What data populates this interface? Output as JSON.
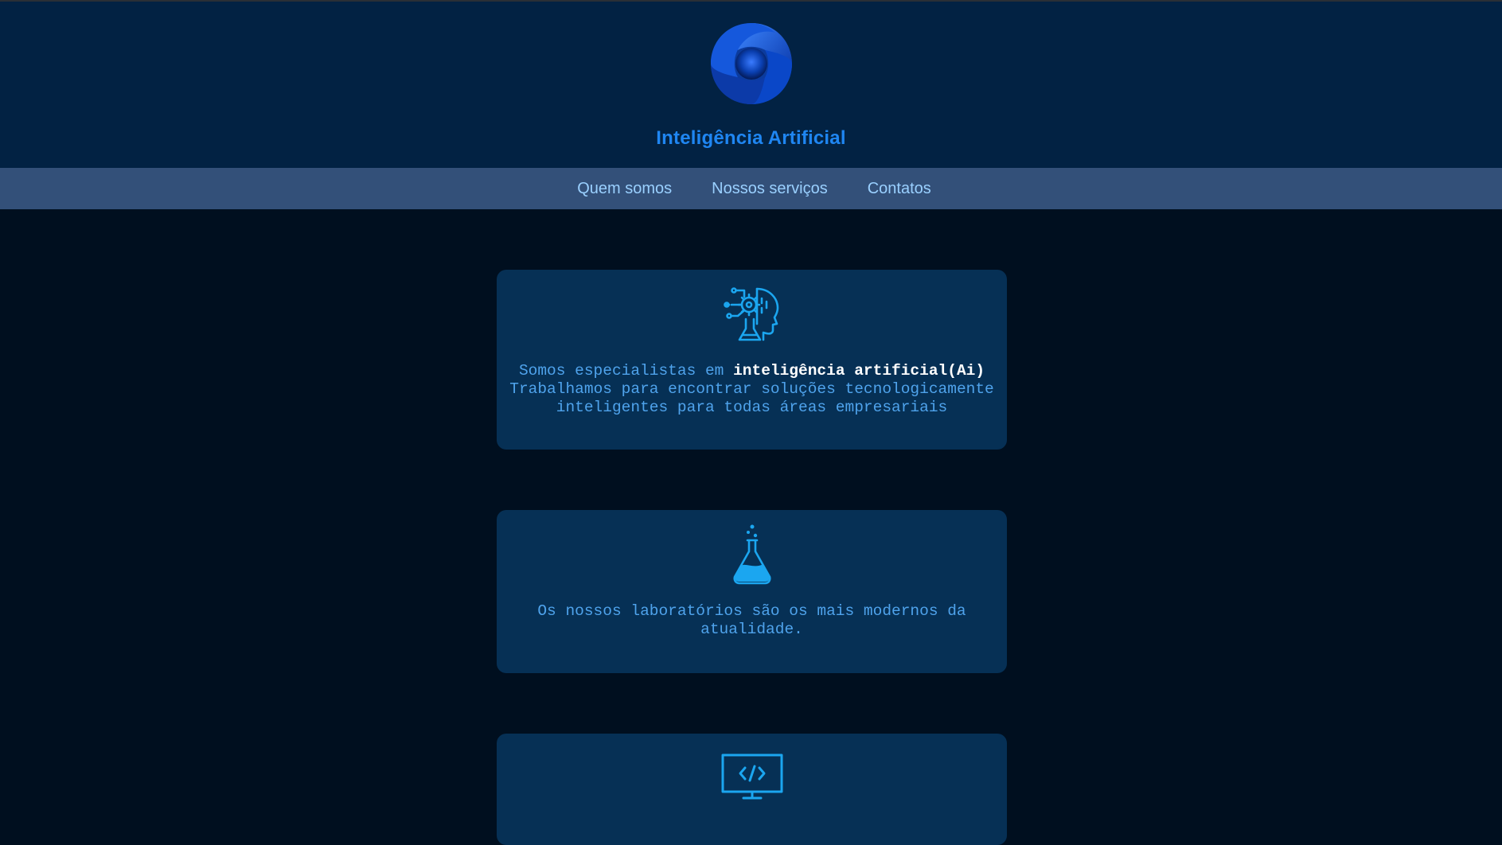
{
  "header": {
    "title": "Inteligência Artificial",
    "logo_icon": "swirl-logo-icon"
  },
  "nav": {
    "items": [
      "Quem somos",
      "Nossos serviços",
      "Contatos"
    ]
  },
  "cards": [
    {
      "icon": "ai-head-gear-icon",
      "text_before": "Somos especialistas em ",
      "text_bold": "inteligência artificial(Ai)",
      "text_after": "Trabalhamos para encontrar soluções tecnologicamente inteligentes para todas áreas empresariais"
    },
    {
      "icon": "lab-flask-icon",
      "text": "Os nossos laboratórios são os mais modernos da atualidade."
    },
    {
      "icon": "code-monitor-icon"
    }
  ],
  "colors": {
    "page_bg": "#000f1f",
    "header_bg": "#022243",
    "nav_bg": "#335079",
    "nav_text": "#9ad0ff",
    "card_bg": "#063055",
    "card_text": "#4fa3ec",
    "accent": "#1f86f2",
    "icon": "#1ba6f0"
  }
}
